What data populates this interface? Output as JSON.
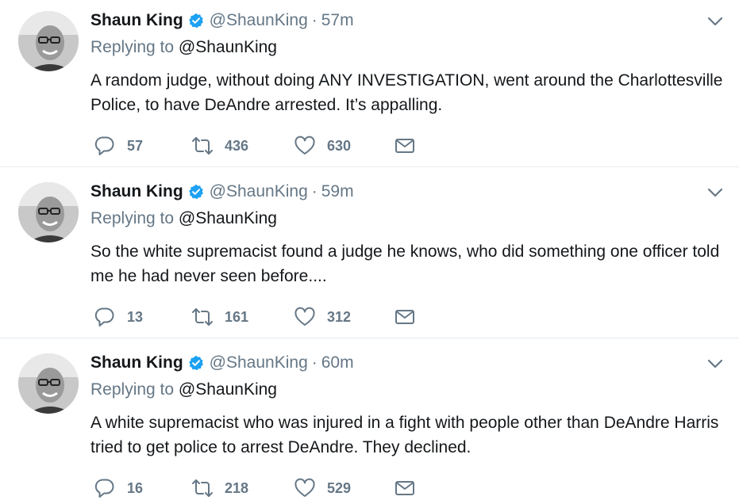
{
  "colors": {
    "verified_blue": "#1da1f2",
    "secondary_text": "#657786",
    "primary_text": "#14171a",
    "divider": "#e6ecf0"
  },
  "icons": {
    "reply": "reply-icon",
    "retweet": "retweet-icon",
    "like": "heart-icon",
    "dm": "envelope-icon",
    "more": "chevron-down-icon",
    "verified": "verified-badge-icon"
  },
  "tweets": [
    {
      "name": "Shaun King",
      "handle": "@ShaunKing",
      "separator": "·",
      "time": "57m",
      "replying_prefix": "Replying to",
      "replying_to": "@ShaunKing",
      "text": "A random judge, without doing ANY INVESTIGATION, went around the Charlottesville Police, to have DeAndre arrested. It’s appalling.",
      "replies": "57",
      "retweets": "436",
      "likes": "630"
    },
    {
      "name": "Shaun King",
      "handle": "@ShaunKing",
      "separator": "·",
      "time": "59m",
      "replying_prefix": "Replying to",
      "replying_to": "@ShaunKing",
      "text": "So the white supremacist found a judge he knows, who did something one officer told me he had never seen before....",
      "replies": "13",
      "retweets": "161",
      "likes": "312"
    },
    {
      "name": "Shaun King",
      "handle": "@ShaunKing",
      "separator": "·",
      "time": "60m",
      "replying_prefix": "Replying to",
      "replying_to": "@ShaunKing",
      "text": "A white supremacist who was injured in a fight with people other than DeAndre Harris tried to get police to arrest DeAndre. They declined.",
      "replies": "16",
      "retweets": "218",
      "likes": "529"
    }
  ]
}
